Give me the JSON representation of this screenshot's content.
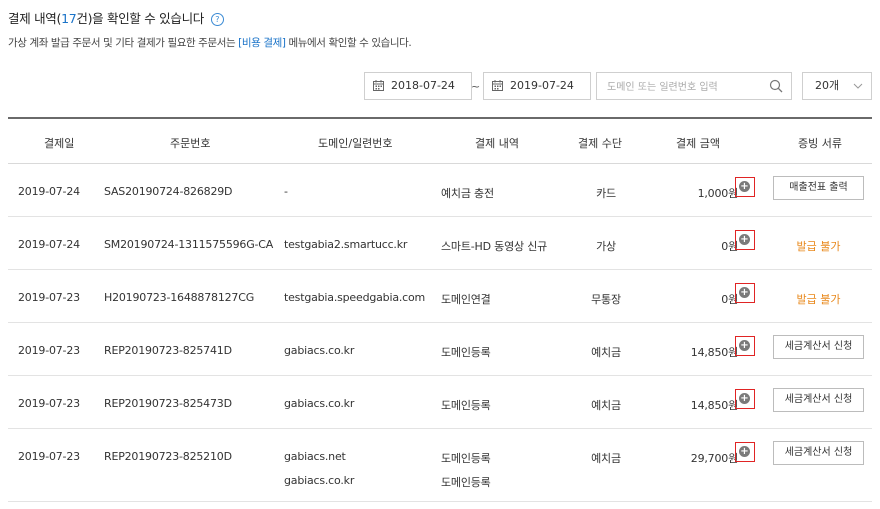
{
  "header": {
    "title_prefix": "결제 내역(",
    "title_count": "17",
    "title_suffix": "건)을 확인할 수 있습니다",
    "help_glyph": "?",
    "subtitle_prefix": "가상 계좌 발급 주문서 및 기타 결제가 필요한 주문서는 ",
    "subtitle_link": "[비용 결제]",
    "subtitle_suffix": " 메뉴에서 확인할 수 있습니다."
  },
  "filters": {
    "start_date": "2018-07-24",
    "separator": "~",
    "end_date": "2019-07-24",
    "search_placeholder": "도메인 또는 일련번호 입력",
    "search_value": "",
    "page_size": "20개"
  },
  "table": {
    "columns": [
      "결제일",
      "주문번호",
      "도메인/일련번호",
      "결제 내역",
      "결제 수단",
      "결제 금액",
      "증빙 서류"
    ],
    "rows": [
      {
        "date": "2019-07-24",
        "order": "SAS20190724-826829D",
        "domain": "-",
        "desc": "예치금 충전",
        "method": "카드",
        "amount": "1,000원",
        "action": "매출전표 출력"
      },
      {
        "date": "2019-07-24",
        "order": "SM20190724-1311575596G-CA",
        "domain": "testgabia2.smartucc.kr",
        "desc": "스마트-HD 동영상 신규",
        "method": "가상",
        "amount": "0원",
        "status": "발급 불가"
      },
      {
        "date": "2019-07-23",
        "order": "H20190723-1648878127CG",
        "domain": "testgabia.speedgabia.com",
        "desc": "도메인연결",
        "method": "무통장",
        "amount": "0원",
        "status": "발급 불가"
      },
      {
        "date": "2019-07-23",
        "order": "REP20190723-825741D",
        "domain": "gabiacs.co.kr",
        "desc": "도메인등록",
        "method": "예치금",
        "amount": "14,850원",
        "action": "세금계산서 신청"
      },
      {
        "date": "2019-07-23",
        "order": "REP20190723-825473D",
        "domain": "gabiacs.co.kr",
        "desc": "도메인등록",
        "method": "예치금",
        "amount": "14,850원",
        "action": "세금계산서 신청"
      },
      {
        "date": "2019-07-23",
        "order": "REP20190723-825210D",
        "domain": "gabiacs.net",
        "domain2": "gabiacs.co.kr",
        "desc": "도메인등록",
        "desc2": "도메인등록",
        "method": "예치금",
        "amount": "29,700원",
        "action": "세금계산서 신청"
      }
    ]
  },
  "icons": {
    "calendar": "calendar-icon",
    "search": "search-icon",
    "dropdown": "chevron-down-icon",
    "detail": "plus-circle-icon"
  },
  "colors": {
    "accent_blue": "#1a73c8",
    "status_orange": "#e8881b",
    "highlight_red": "#e02424"
  }
}
